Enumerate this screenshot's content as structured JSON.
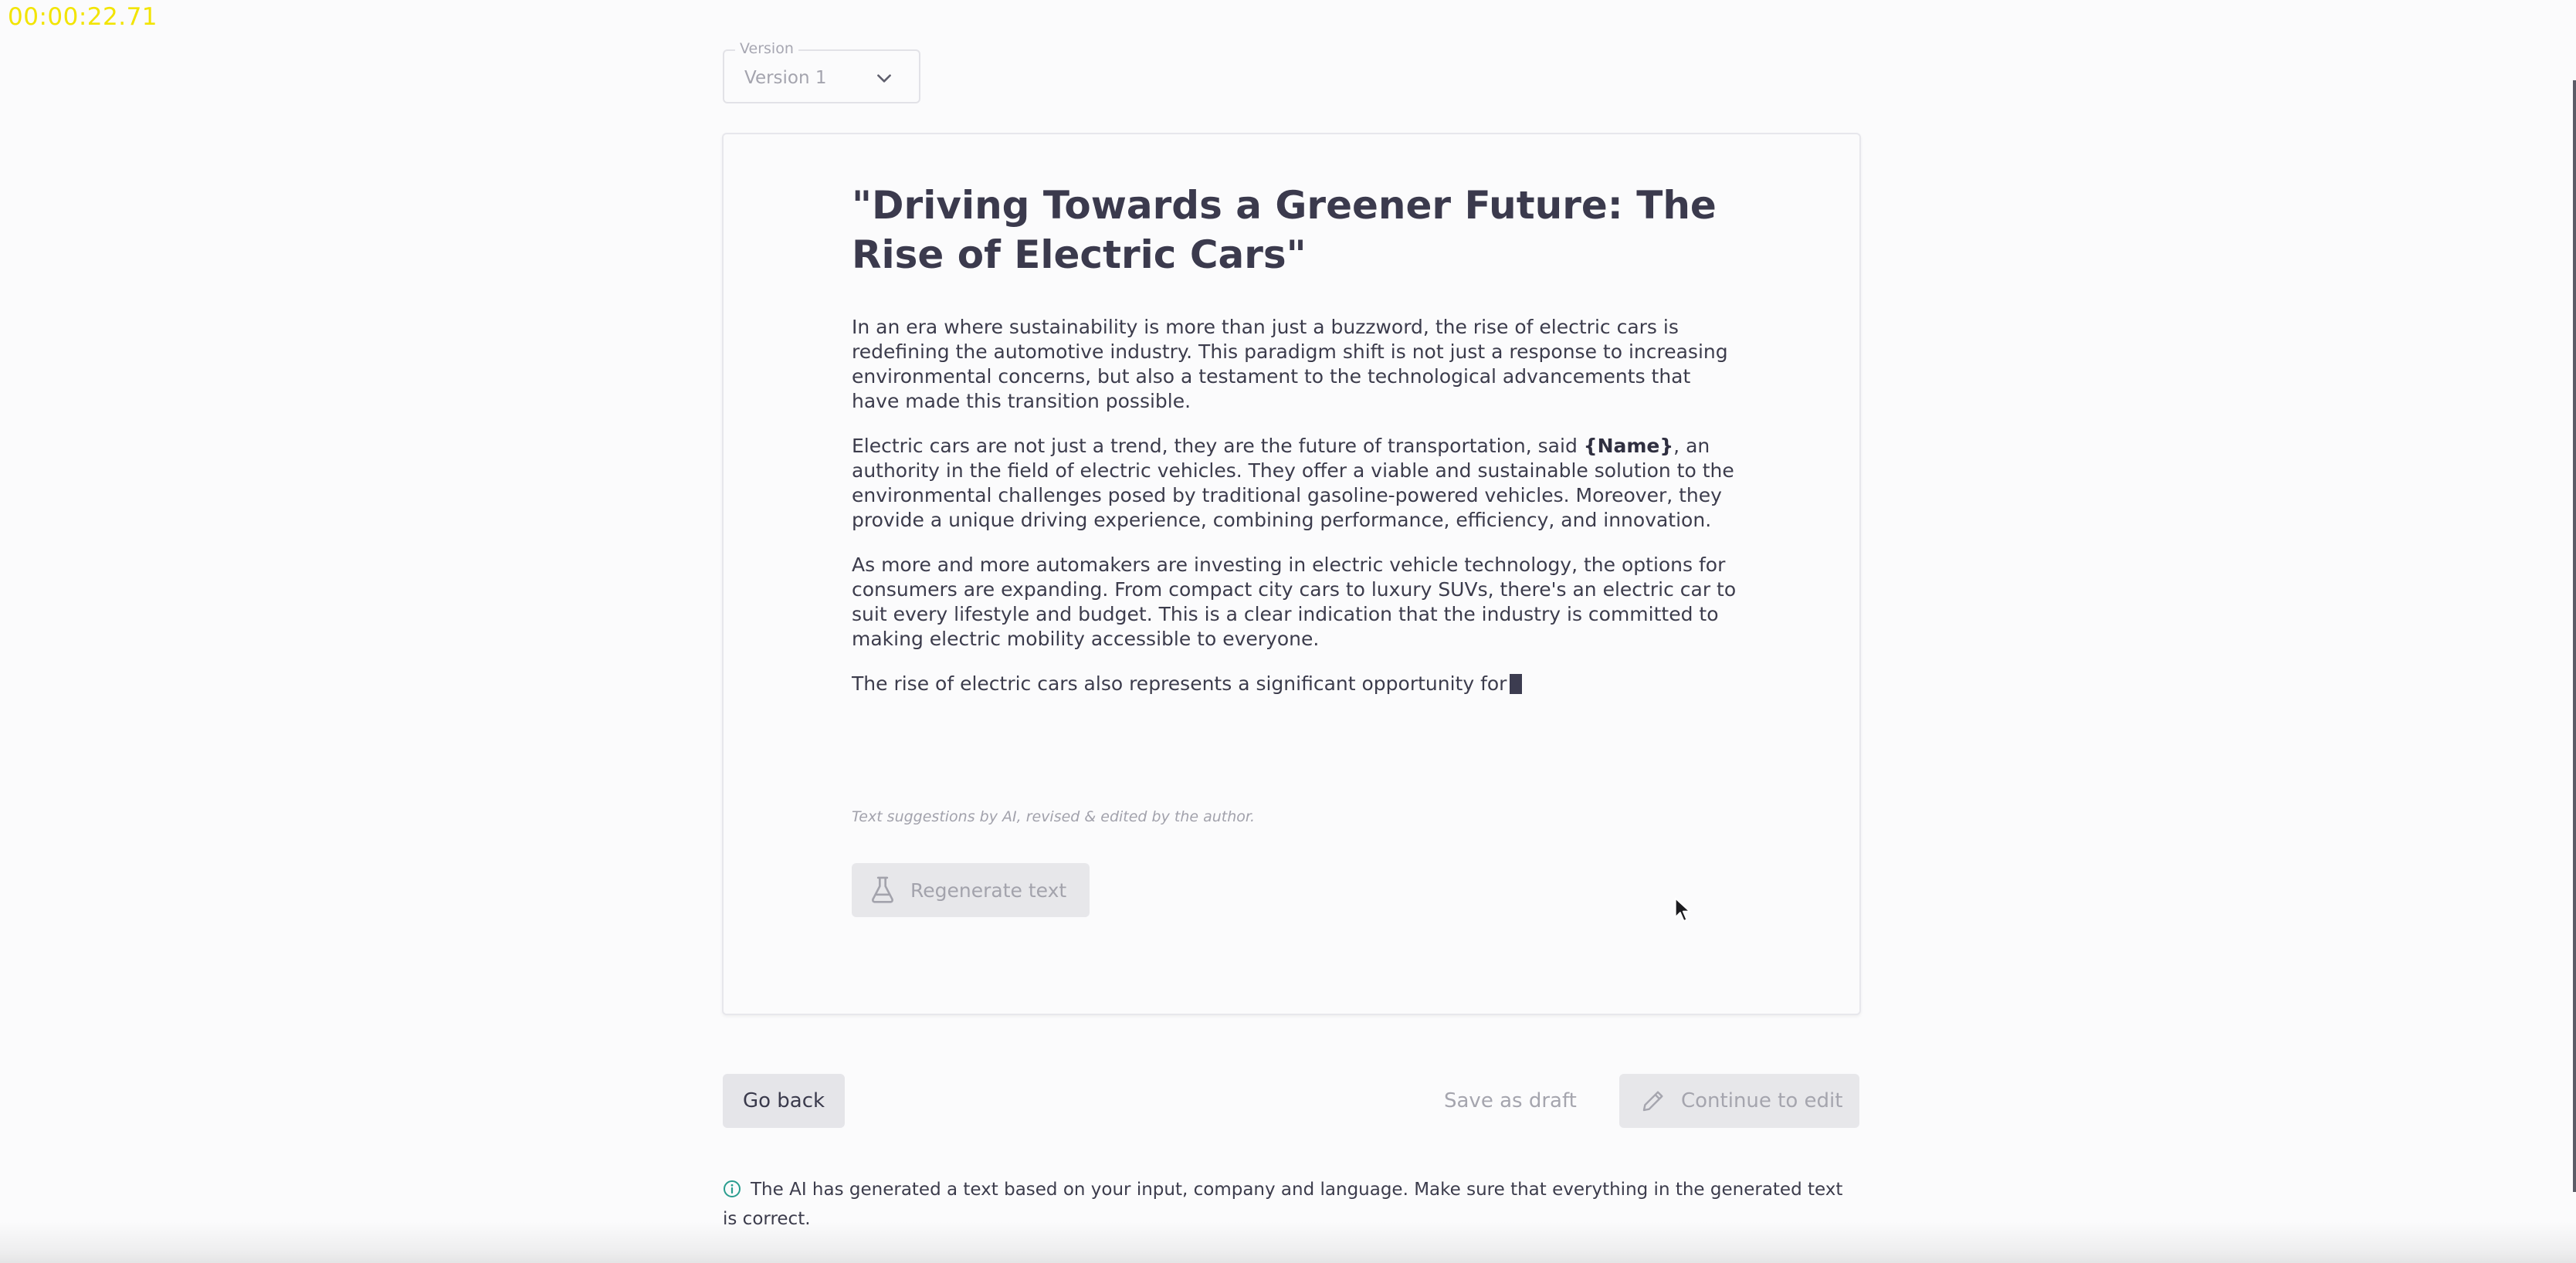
{
  "recording": {
    "timer": "00:00:22.71"
  },
  "version_select": {
    "label": "Version",
    "value": "Version 1",
    "chevron_icon": "chevron-down-icon"
  },
  "article": {
    "title": "\"Driving Towards a Greener Future: The Rise of Electric Cars\"",
    "paragraphs": [
      "In an era where sustainability is more than just a buzzword, the rise of electric cars is redefining the automotive industry. This paradigm shift is not just a response to increasing environmental concerns, but also a testament to the technological advancements that have made this transition possible.",
      {
        "before": "Electric cars are not just a trend, they are the future of transportation, said ",
        "placeholder": "{Name}",
        "after": ", an authority in the field of electric vehicles. They offer a viable and sustainable solution to the environmental challenges posed by traditional gasoline-powered vehicles. Moreover, they provide a unique driving experience, combining performance, efficiency, and innovation."
      },
      "As more and more automakers are investing in electric vehicle technology, the options for consumers are expanding. From compact city cars to luxury SUVs, there's an electric car to suit every lifestyle and budget. This is a clear indication that the industry is committed to making electric mobility accessible to everyone.",
      "The rise of electric cars also represents a significant opportunity for"
    ],
    "ai_note": "Text suggestions by AI, revised & edited by the author."
  },
  "regenerate_button": {
    "label": "Regenerate text",
    "icon": "flask-icon",
    "disabled": true
  },
  "footer": {
    "go_back": "Go back",
    "save_draft": "Save as draft",
    "continue": "Continue to edit",
    "continue_icon": "pencil-icon"
  },
  "info": {
    "icon": "info-icon",
    "text": "The AI has generated a text based on your input, company and language. Make sure that everything in the generated text is correct."
  },
  "colors": {
    "timer": "#f2e400",
    "info_icon": "#2a9d8f",
    "disabled_text": "#a5a5ae",
    "heading": "#3b3a4d"
  }
}
